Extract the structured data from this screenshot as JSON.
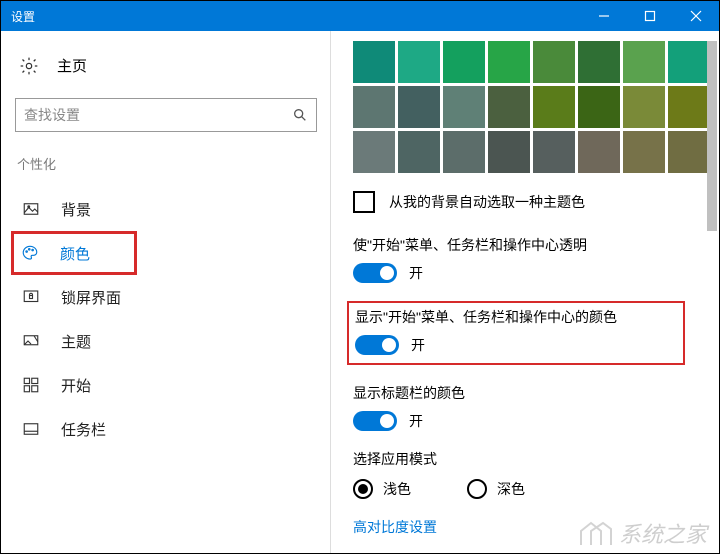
{
  "titlebar": {
    "title": "设置"
  },
  "sidebar": {
    "home": "主页",
    "search_placeholder": "查找设置",
    "section": "个性化",
    "items": [
      {
        "label": "背景"
      },
      {
        "label": "颜色"
      },
      {
        "label": "锁屏界面"
      },
      {
        "label": "主题"
      },
      {
        "label": "开始"
      },
      {
        "label": "任务栏"
      }
    ]
  },
  "colors": {
    "swatches": [
      [
        "#0f8a78",
        "#1ea985",
        "#14a05e",
        "#27a547",
        "#4a8a3a",
        "#2f6f34",
        "#5aa24e",
        "#13a07a"
      ],
      [
        "#5d7671",
        "#436060",
        "#5f8076",
        "#4b603f",
        "#5a7c1a",
        "#3b6515",
        "#7a8a38",
        "#6d7a18"
      ],
      [
        "#6b7a79",
        "#4e6563",
        "#5c6d6a",
        "#4b5551",
        "#565f5e",
        "#6f685a",
        "#777249",
        "#706d42"
      ]
    ],
    "auto_from_bg": "从我的背景自动选取一种主题色",
    "transparency": {
      "label": "使\"开始\"菜单、任务栏和操作中心透明",
      "state": "开"
    },
    "show_color": {
      "label": "显示\"开始\"菜单、任务栏和操作中心的颜色",
      "state": "开"
    },
    "titlebar_color": {
      "label": "显示标题栏的颜色",
      "state": "开"
    },
    "mode": {
      "label": "选择应用模式",
      "light": "浅色",
      "dark": "深色"
    },
    "high_contrast": "高对比度设置"
  },
  "watermark": "系统之家"
}
